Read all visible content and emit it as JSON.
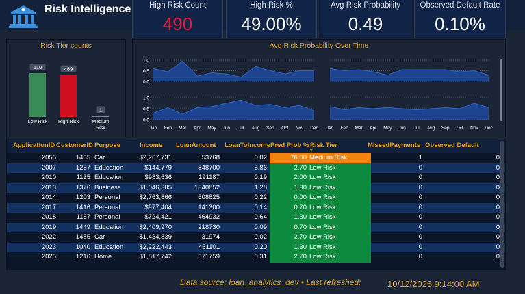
{
  "app": {
    "title": "Risk Intelligence"
  },
  "kpis": [
    {
      "label": "High Risk Count",
      "value": "490"
    },
    {
      "label": "High Risk %",
      "value": "49.00%"
    },
    {
      "label": "Avg Risk Probability",
      "value": "0.49"
    },
    {
      "label": "Observed Default Rate",
      "value": "0.10%"
    }
  ],
  "tier_chart": {
    "title": "Risk Tier counts",
    "chart_data": {
      "type": "bar",
      "categories": [
        "Low Risk",
        "High Risk",
        "Medium Risk"
      ],
      "values": [
        510,
        489,
        1
      ],
      "data_labels": [
        "510",
        "489",
        "1"
      ],
      "colors": [
        "#3a8a55",
        "#d0101e",
        "#888888"
      ]
    }
  },
  "time_chart": {
    "title": "Avg Risk Probability Over Time",
    "chart_data": [
      {
        "type": "area",
        "categories": [
          "Jan",
          "Feb",
          "Mar",
          "Apr",
          "May",
          "Jun",
          "Jul",
          "Aug",
          "Sep",
          "Oct",
          "Nov",
          "Dec"
        ],
        "y_ticks": [
          "1.0",
          "0.5",
          "0.0"
        ],
        "ylim": [
          0,
          1
        ],
        "series": [
          {
            "values": [
              0.6,
              0.45,
              0.95,
              0.25,
              0.4,
              0.35,
              0.2,
              0.7,
              0.5,
              0.35,
              0.5,
              0.5
            ]
          }
        ]
      },
      {
        "type": "area",
        "categories": [
          "Jan",
          "Feb",
          "Mar",
          "Apr",
          "May",
          "Jun",
          "Jul",
          "Aug",
          "Sep",
          "Oct",
          "Nov",
          "Dec"
        ],
        "y_ticks": [],
        "ylim": [
          0,
          1
        ],
        "series": [
          {
            "values": [
              0.6,
              0.5,
              0.55,
              0.45,
              0.3,
              0.55,
              0.55,
              0.55,
              0.55,
              0.45,
              0.5,
              0.3
            ]
          }
        ]
      },
      {
        "type": "area",
        "categories": [
          "Jan",
          "Feb",
          "Mar",
          "Apr",
          "May",
          "Jun",
          "Jul",
          "Aug",
          "Sep",
          "Oct",
          "Nov",
          "Dec"
        ],
        "y_ticks": [
          "1.0",
          "0.5",
          "0.0"
        ],
        "ylim": [
          0,
          1
        ],
        "series": [
          {
            "values": [
              0.3,
              0.55,
              0.25,
              0.55,
              0.6,
              0.75,
              0.9,
              0.65,
              0.7,
              0.55,
              0.65,
              0.4
            ]
          }
        ]
      },
      {
        "type": "area",
        "categories": [
          "Jan",
          "Feb",
          "Mar",
          "Apr",
          "May",
          "Jun",
          "Jul",
          "Aug",
          "Sep",
          "Oct",
          "Nov",
          "Dec"
        ],
        "y_ticks": [],
        "ylim": [
          0,
          1
        ],
        "series": [
          {
            "values": [
              0.6,
              0.45,
              0.55,
              0.5,
              0.55,
              0.5,
              0.45,
              0.5,
              0.55,
              0.5,
              0.75,
              0.55
            ]
          }
        ]
      }
    ]
  },
  "table": {
    "columns": [
      "ApplicationID",
      "CustomerID",
      "Purpose",
      "Income",
      "LoanAmount",
      "LoanToIncome",
      "Pred Prob %",
      "Risk Tier",
      "MissedPayments",
      "Observed Default"
    ],
    "sort_indicator": "▾",
    "rows": [
      [
        "2055",
        "1465",
        "Car",
        "$2,267,731",
        "53768",
        "0.02",
        "76.00",
        "Medium Risk",
        "1",
        "0"
      ],
      [
        "2007",
        "1257",
        "Education",
        "$144,779",
        "848700",
        "5.86",
        "2.70",
        "Low Risk",
        "0",
        "0"
      ],
      [
        "2010",
        "1135",
        "Education",
        "$983,636",
        "191187",
        "0.19",
        "2.00",
        "Low Risk",
        "0",
        "0"
      ],
      [
        "2013",
        "1376",
        "Business",
        "$1,046,305",
        "1340852",
        "1.28",
        "1.30",
        "Low Risk",
        "0",
        "0"
      ],
      [
        "2014",
        "1203",
        "Personal",
        "$2,763,866",
        "608825",
        "0.22",
        "0.00",
        "Low Risk",
        "0",
        "0"
      ],
      [
        "2017",
        "1416",
        "Personal",
        "$977,404",
        "141300",
        "0.14",
        "0.70",
        "Low Risk",
        "0",
        "0"
      ],
      [
        "2018",
        "1157",
        "Personal",
        "$724,421",
        "464932",
        "0.64",
        "1.30",
        "Low Risk",
        "0",
        "0"
      ],
      [
        "2019",
        "1449",
        "Education",
        "$2,409,970",
        "218730",
        "0.09",
        "0.70",
        "Low Risk",
        "0",
        "0"
      ],
      [
        "2022",
        "1485",
        "Car",
        "$1,434,839",
        "31974",
        "0.02",
        "2.70",
        "Low Risk",
        "0",
        "0"
      ],
      [
        "2023",
        "1040",
        "Education",
        "$2,222,443",
        "451101",
        "0.20",
        "1.30",
        "Low Risk",
        "0",
        "0"
      ],
      [
        "2025",
        "1216",
        "Home",
        "$1,817,742",
        "571759",
        "0.31",
        "2.70",
        "Low Risk",
        "0",
        "0"
      ]
    ],
    "tier_colors": {
      "Medium Risk": "#f5820a",
      "Low Risk": "#0e8a3e"
    }
  },
  "footer": {
    "source": "Data source: loan_analytics_dev • Last refreshed:",
    "refreshed": "10/12/2025 9:14:00 AM"
  }
}
